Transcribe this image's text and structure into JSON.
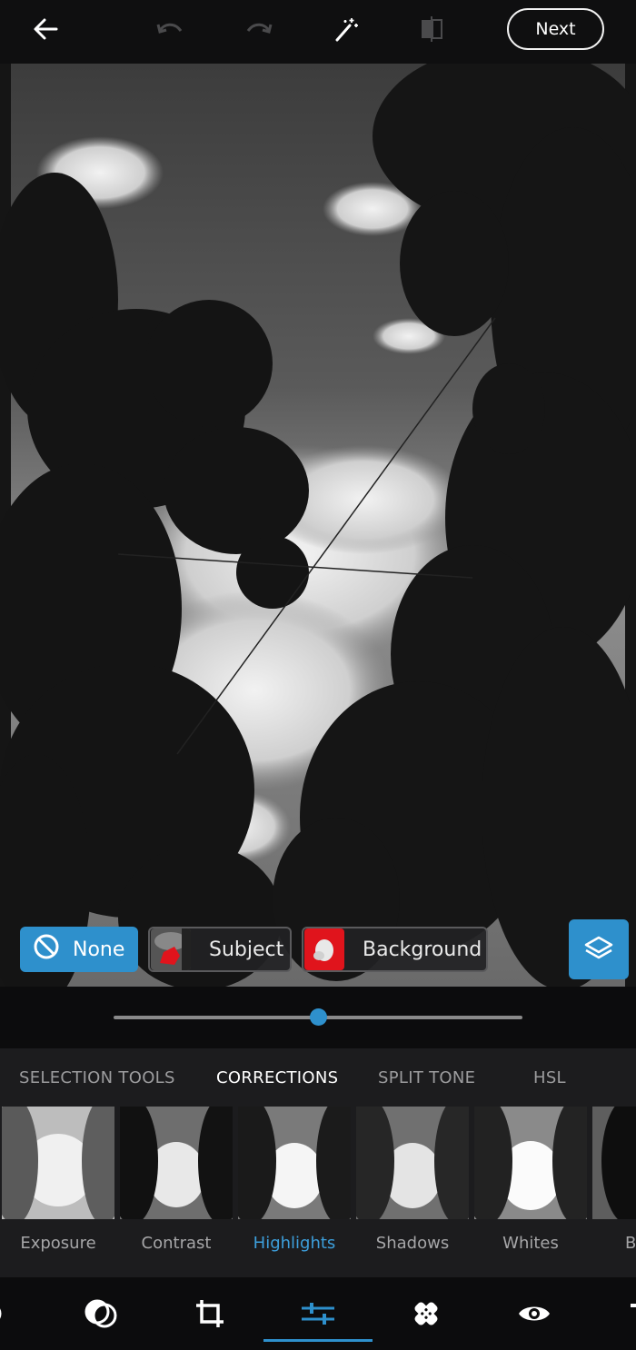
{
  "topbar": {
    "back": "back-arrow",
    "undo": "undo",
    "redo": "redo",
    "auto_fix": "magic-wand",
    "compare": "compare-before-after",
    "next_label": "Next"
  },
  "selection": {
    "none_label": "None",
    "subject_label": "Subject",
    "background_label": "Background",
    "layers": "layers"
  },
  "slider": {
    "value": 0.5
  },
  "tabs": [
    {
      "label": "SELECTION TOOLS",
      "active": false
    },
    {
      "label": "CORRECTIONS",
      "active": true
    },
    {
      "label": "SPLIT TONE",
      "active": false
    },
    {
      "label": "HSL",
      "active": false
    }
  ],
  "presets": [
    {
      "label": "Exposure",
      "active": false
    },
    {
      "label": "Contrast",
      "active": false
    },
    {
      "label": "Highlights",
      "active": true
    },
    {
      "label": "Shadows",
      "active": false
    },
    {
      "label": "Whites",
      "active": false
    },
    {
      "label": "B",
      "active": false
    }
  ],
  "bottom_nav": [
    "looks",
    "overlays",
    "crop",
    "adjustments",
    "healing",
    "red-eye",
    "text"
  ],
  "colors": {
    "accent": "#2e90cc",
    "active_text": "#3d9fdc",
    "mask_red": "#e0141c"
  }
}
